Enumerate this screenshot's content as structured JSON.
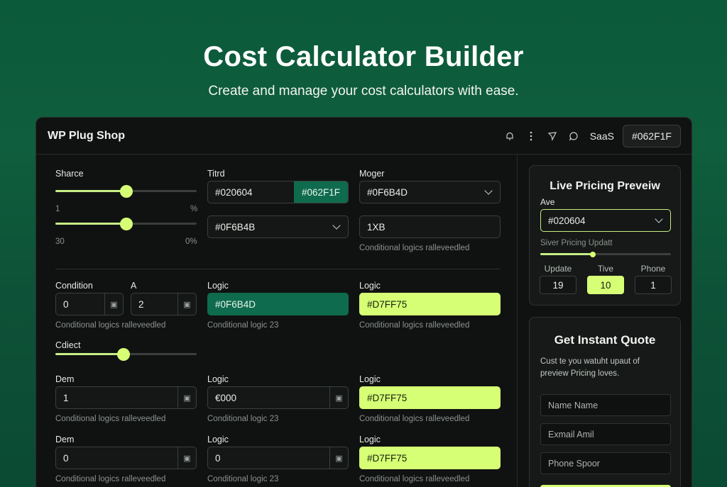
{
  "hero": {
    "title": "Cost Calculator Builder",
    "subtitle": "Create and manage your cost calculators with ease."
  },
  "topbar": {
    "brand": "WP Plug Shop",
    "icons": [
      "bell-icon",
      "more-vertical-icon",
      "send-icon",
      "chat-icon"
    ],
    "saas_label": "SaaS",
    "color_button": "#062F1F"
  },
  "form": {
    "row1": {
      "col1": {
        "label": "Sharce",
        "slider1": {
          "value": 0.5,
          "min_label": "1",
          "max_label": "%"
        },
        "slider2": {
          "value": 0.5,
          "min_label": "30",
          "max_label": "0%"
        }
      },
      "col2": {
        "label": "Titrd",
        "input_value": "#020604",
        "input_addon": "#062F1F",
        "select2_value": "#0F6B4B"
      },
      "col3": {
        "label": "Moger",
        "select_value": "#0F6B4D",
        "input2_value": "1XB",
        "helper": "Conditional logics ralleveedled"
      }
    },
    "row2": {
      "condition_label": "Condition",
      "condition_value": "0",
      "a_label": "A",
      "a_value": "2",
      "col1_helper": "Conditional logics ralleveedled",
      "col2_label": "Logic",
      "col2_value": "#0F6B4D",
      "col2_helper": "Conditional logic 23",
      "col3_label": "Logic",
      "col3_value": "#D7FF75",
      "col3_helper": "Conditional logics ralleveedled"
    },
    "collect": {
      "label": "Cdiect",
      "value": 0.48
    },
    "row3": {
      "col1_label": "Dem",
      "col1_value": "1",
      "col1_helper": "Conditional logics ralleveedled",
      "col2_label": "Logic",
      "col2_value": "€000",
      "col2_helper": "Conditional logic 23",
      "col3_label": "Logic",
      "col3_value": "#D7FF75",
      "col3_helper": "Conditional logics ralleveedled"
    },
    "row4": {
      "col1_label": "Dem",
      "col1_value": "0",
      "col1_helper": "Conditional logics ralleveedled",
      "col2_label": "Logic",
      "col2_value": "0",
      "col2_helper": "Conditional logic 23",
      "col3_label": "Logic",
      "col3_value": "#D7FF75",
      "col3_helper": "Conditional logics ralleveedled"
    }
  },
  "preview": {
    "title": "Live Pricing Preveiw",
    "ave_label": "Ave",
    "select_value": "#020604",
    "slider_label": "Siver Pricing Updatt",
    "slider_value": 0.4,
    "columns": [
      {
        "label": "Update",
        "value": "19"
      },
      {
        "label": "Tive",
        "value": "10"
      },
      {
        "label": "Phone",
        "value": "1"
      }
    ]
  },
  "quote": {
    "title": "Get Instant Quote",
    "description_line1": "Cust te you watuht upaut of",
    "description_line2": "preview Pricing loves.",
    "name_placeholder": "Name Name",
    "email_placeholder": "Exmail Amil",
    "phone_placeholder": "Phone Spoor"
  },
  "colors": {
    "accent_green": "#0F6B4D",
    "accent_lime": "#D7FF75",
    "background_dark": "#101211"
  }
}
